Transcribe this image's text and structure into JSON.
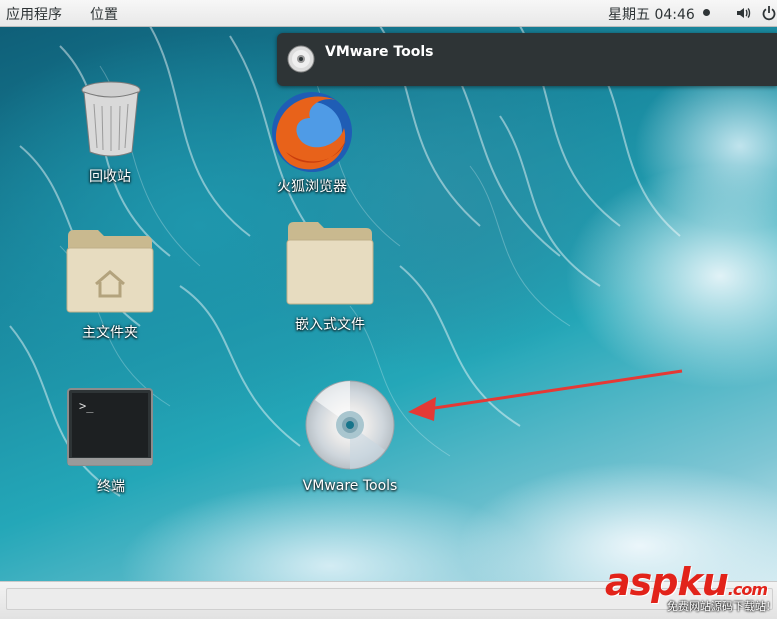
{
  "topbar": {
    "apps_menu": "应用程序",
    "places_menu": "位置",
    "clock": "星期五 04:46",
    "volume_icon": "speaker-icon",
    "power_icon": "power-icon"
  },
  "notification": {
    "title": "VMware Tools",
    "icon": "cd-icon"
  },
  "desktop": {
    "icons": [
      {
        "label": "回收站",
        "icon": "trash-icon"
      },
      {
        "label": "火狐浏览器",
        "icon": "firefox-icon"
      },
      {
        "label": "主文件夹",
        "icon": "home-folder-icon"
      },
      {
        "label": "嵌入式文件",
        "icon": "folder-icon"
      },
      {
        "label": "终端",
        "icon": "terminal-icon"
      },
      {
        "label": "VMware Tools",
        "icon": "cd-icon"
      }
    ]
  },
  "watermark": {
    "brand": "aspku",
    "tld": ".com",
    "tagline": "免费网站源码下载站!"
  },
  "colors": {
    "topbar": "#ececec",
    "notification_bg": "#2e3436",
    "arrow": "#e53935",
    "watermark": "#e2231a"
  }
}
